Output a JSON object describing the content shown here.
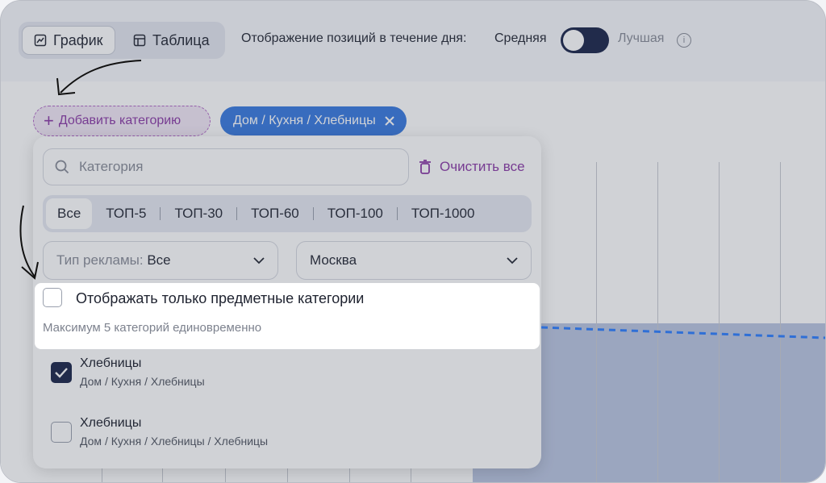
{
  "toolbar": {
    "view_tabs": [
      {
        "label": "График",
        "icon": "chart-icon",
        "active": true
      },
      {
        "label": "Таблица",
        "icon": "table-icon",
        "active": false
      }
    ],
    "position_display_label": "Отображение позиций в течение дня:",
    "mode_average": "Средняя",
    "mode_best": "Лучшая",
    "toggle_on": false
  },
  "filters": {
    "add_category_label": "Добавить категорию",
    "selected_chip": "Дом / Кухня / Хлебницы"
  },
  "panel": {
    "search_placeholder": "Категория",
    "clear_all_label": "Очистить все",
    "top_options": [
      "Все",
      "ТОП-5",
      "ТОП-30",
      "ТОП-60",
      "ТОП-100",
      "ТОП-1000"
    ],
    "top_selected": "Все",
    "ad_type_label": "Тип рекламы:",
    "ad_type_value": "Все",
    "region_value": "Москва",
    "subject_only_label": "Отображать только предметные категории",
    "max_note": "Максимум 5 категорий единовременно",
    "items": [
      {
        "title": "Хлебницы",
        "path": "Дом / Кухня / Хлебницы",
        "checked": true
      },
      {
        "title": "Хлебницы",
        "path": "Дом / Кухня / Хлебницы / Хлебницы",
        "checked": false
      }
    ]
  },
  "colors": {
    "accent_blue": "#3d7de0",
    "accent_purple": "#8e3fa8",
    "toggle_dark": "#1f2a4d"
  }
}
